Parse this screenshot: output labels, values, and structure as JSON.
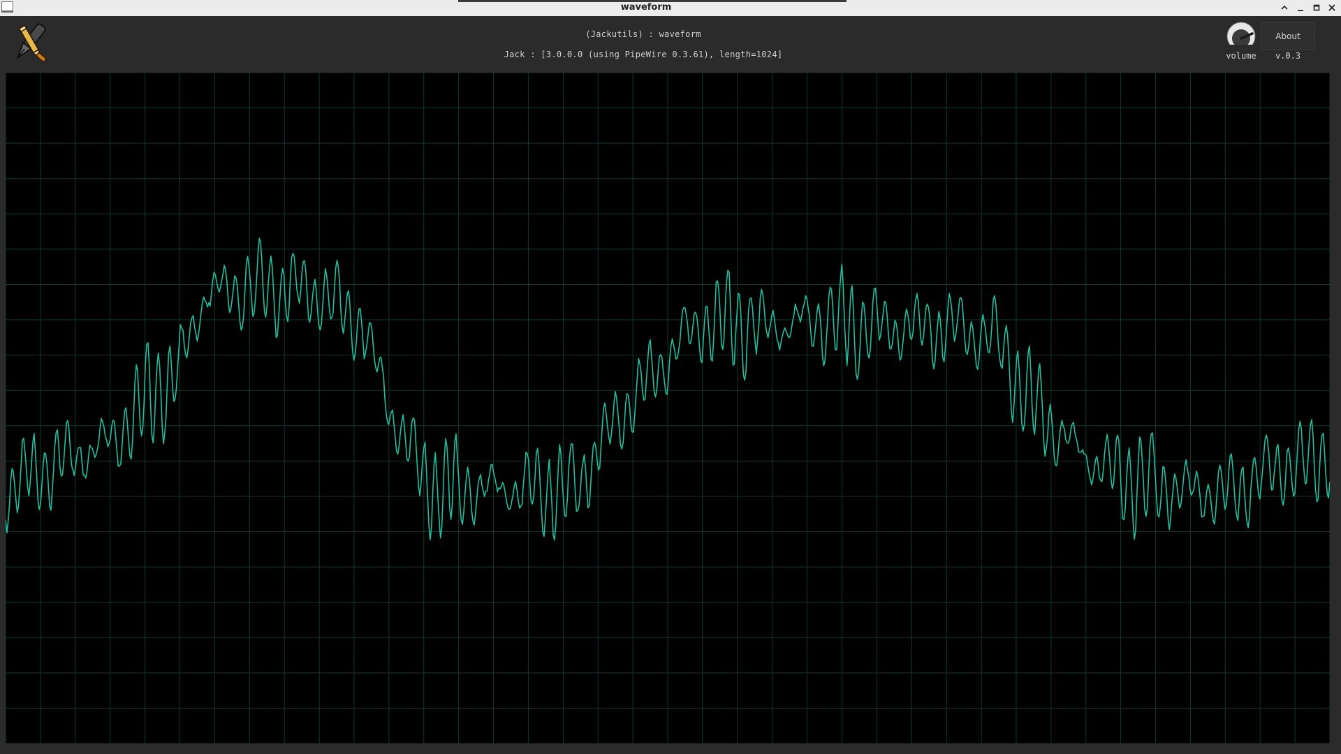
{
  "window": {
    "title": "waveform"
  },
  "header": {
    "app_title": "(Jackutils) : waveform",
    "jack_info": "Jack : [3.0.0.0 (using PipeWire 0.3.61), length=1024]",
    "volume_label": "volume",
    "about_label": "About",
    "version_label": "v.0.3"
  },
  "colors": {
    "waveform": "#1fbf9f",
    "grid": "#0f3a30",
    "scope_bg": "#000000",
    "panel_bg": "#2b2b2b",
    "text": "#d0d0d0"
  },
  "icons": {
    "app_logo": "pen-and-pencil-icon",
    "volume": "knob-icon",
    "window_shade": "chevron-up-icon",
    "window_minimize": "minimize-icon",
    "window_maximize": "maximize-icon",
    "window_close": "close-icon"
  }
}
